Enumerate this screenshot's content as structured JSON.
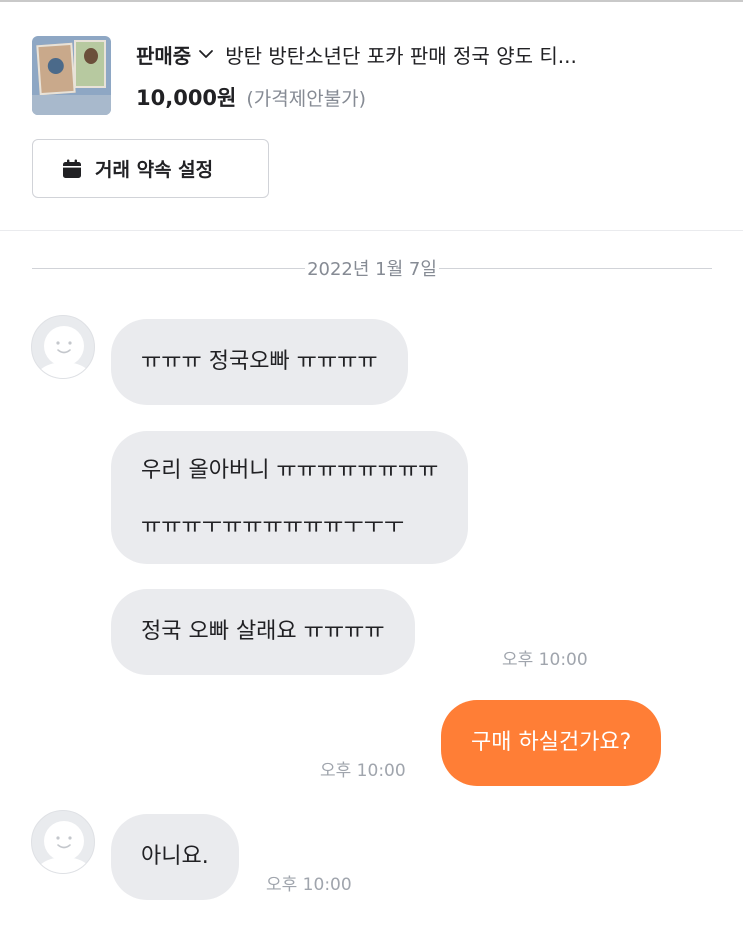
{
  "product": {
    "status": "판매중",
    "title": "방탄 방탄소년단 포카 판매 정국 양도 티...",
    "price": "10,000원",
    "price_note": "(가격제안불가)"
  },
  "actions": {
    "promise_label": "거래 약속 설정"
  },
  "chat": {
    "date": "2022년 1월 7일",
    "messages": [
      {
        "sender": "other",
        "text": "ㅠㅠㅠ 정국오빠 ㅠㅠㅠㅠ"
      },
      {
        "sender": "other",
        "line1": "우리 올아버니 ㅠㅠㅠㅠㅠㅠㅠㅠ",
        "line2": "ㅠㅠㅠㅜㅠㅠㅠㅠㅠㅠㅜㅜㅜ"
      },
      {
        "sender": "other",
        "text": "정국 오빠 살래요 ㅠㅠㅠㅠ",
        "time": "오후 10:00"
      },
      {
        "sender": "me",
        "text": "구매 하실건가요?",
        "time": "오후 10:00"
      },
      {
        "sender": "other",
        "text": "아니요.",
        "time": "오후 10:00"
      }
    ]
  },
  "icons": {
    "thumbnail": "product-thumbnail",
    "dropdown": "chevron-down-icon",
    "calendar": "calendar-icon",
    "avatar": "default-avatar-icon"
  },
  "colors": {
    "accent": "#ff7e36",
    "bubble_other": "#eaebee",
    "muted_text": "#868b94"
  }
}
